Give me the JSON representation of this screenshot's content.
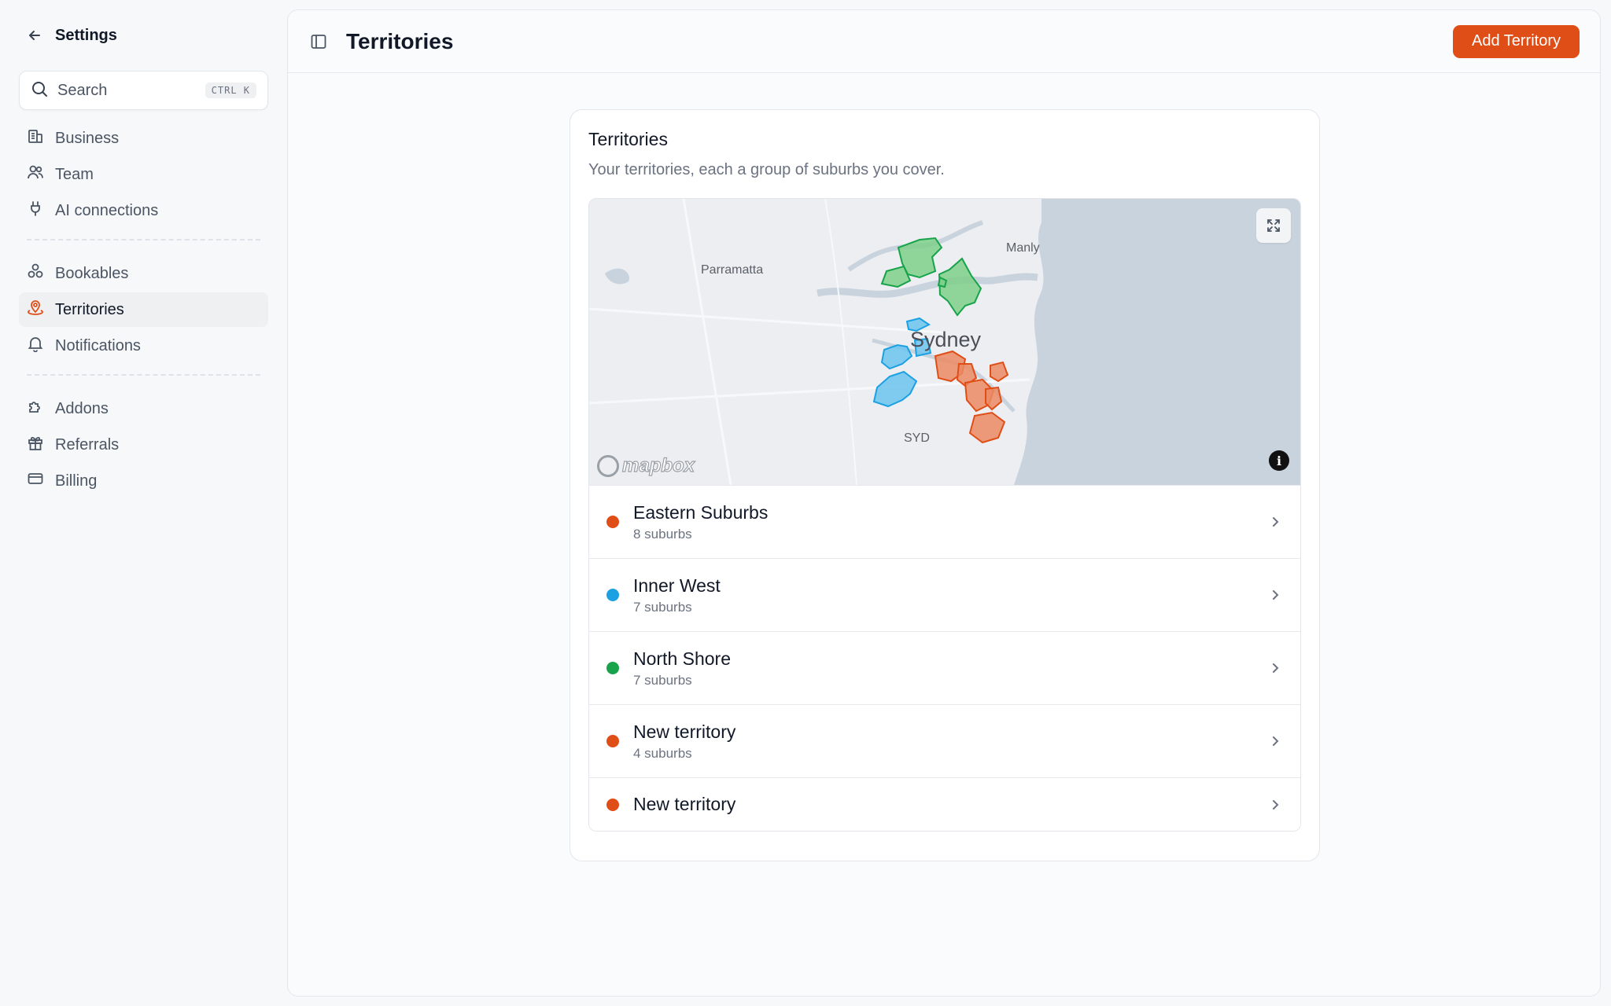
{
  "sidebar": {
    "title": "Settings",
    "search": {
      "placeholder": "Search",
      "shortcut": "CTRL K"
    },
    "groups": [
      [
        {
          "label": "Business",
          "icon": "building-icon"
        },
        {
          "label": "Team",
          "icon": "users-icon"
        },
        {
          "label": "AI connections",
          "icon": "plug-icon"
        }
      ],
      [
        {
          "label": "Bookables",
          "icon": "shapes-icon"
        },
        {
          "label": "Territories",
          "icon": "map-pin-icon",
          "active": true
        },
        {
          "label": "Notifications",
          "icon": "bell-icon"
        }
      ],
      [
        {
          "label": "Addons",
          "icon": "puzzle-icon"
        },
        {
          "label": "Referrals",
          "icon": "gift-icon"
        },
        {
          "label": "Billing",
          "icon": "credit-card-icon"
        }
      ]
    ]
  },
  "header": {
    "title": "Territories",
    "add_button": "Add Territory"
  },
  "card": {
    "title": "Territories",
    "subtitle": "Your territories, each a group of suburbs you cover."
  },
  "map": {
    "labels": {
      "parramatta": "Parramatta",
      "manly": "Manly",
      "sydney": "Sydney",
      "syd": "SYD"
    },
    "attribution": "mapbox"
  },
  "territories": [
    {
      "name": "Eastern Suburbs",
      "count": "8 suburbs",
      "color": "#e04e17"
    },
    {
      "name": "Inner West",
      "count": "7 suburbs",
      "color": "#1ba1e2"
    },
    {
      "name": "North Shore",
      "count": "7 suburbs",
      "color": "#16a34a"
    },
    {
      "name": "New territory",
      "count": "4 suburbs",
      "color": "#e04e17"
    },
    {
      "name": "New territory",
      "count": "",
      "color": "#e04e17"
    }
  ],
  "colors": {
    "accent": "#e04e17",
    "water": "#c9d3de",
    "land": "#eceef1"
  }
}
